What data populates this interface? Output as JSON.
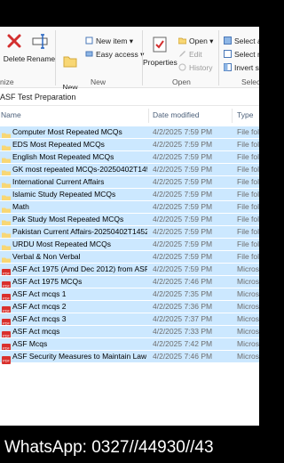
{
  "ribbon": {
    "delete_label": "Delete",
    "rename_label": "Rename",
    "new_folder_label": "New\nfolder",
    "new_item_label": "New item ▾",
    "easy_access_label": "Easy access ▾",
    "properties_label": "Properties",
    "open_label": "Open ▾",
    "edit_label": "Edit",
    "history_label": "History",
    "select_all_label": "Select all",
    "select_none_label": "Select no",
    "invert_selection_label": "Invert se",
    "group_organize": "nize",
    "group_new": "New",
    "group_open": "Open",
    "group_select": "Selec"
  },
  "address": {
    "crumb": "ASF Test Preparation"
  },
  "columns": {
    "name": "Name",
    "date": "Date modified",
    "type": "Type"
  },
  "files": [
    {
      "name": "Computer Most Repeated MCQs",
      "date": "4/2/2025 7:59 PM",
      "type": "File fold",
      "kind": "folder"
    },
    {
      "name": "EDS Most Repeated MCQs",
      "date": "4/2/2025 7:59 PM",
      "type": "File fold",
      "kind": "folder"
    },
    {
      "name": "English Most Repeated MCQs",
      "date": "4/2/2025 7:59 PM",
      "type": "File fold",
      "kind": "folder"
    },
    {
      "name": "GK most repeated MCQs-20250402T1451...",
      "date": "4/2/2025 7:59 PM",
      "type": "File fold",
      "kind": "folder"
    },
    {
      "name": "International Current Affairs",
      "date": "4/2/2025 7:59 PM",
      "type": "File fold",
      "kind": "folder"
    },
    {
      "name": "Islamic Study Repeated MCQs",
      "date": "4/2/2025 7:59 PM",
      "type": "File fold",
      "kind": "folder"
    },
    {
      "name": "Math",
      "date": "4/2/2025 7:59 PM",
      "type": "File fold",
      "kind": "folder"
    },
    {
      "name": "Pak Study Most Repeated MCQs",
      "date": "4/2/2025 7:59 PM",
      "type": "File fold",
      "kind": "folder"
    },
    {
      "name": "Pakistan Current Affairs-20250402T14523...",
      "date": "4/2/2025 7:59 PM",
      "type": "File fold",
      "kind": "folder"
    },
    {
      "name": "URDU Most Repeated MCQs",
      "date": "4/2/2025 7:59 PM",
      "type": "File fold",
      "kind": "folder"
    },
    {
      "name": "Verbal & Non Verbal",
      "date": "4/2/2025 7:59 PM",
      "type": "File fold",
      "kind": "folder"
    },
    {
      "name": "ASF Act 1975 (Amd Dec 2012) from ASF ...",
      "date": "4/2/2025 7:59 PM",
      "type": "Microsc",
      "kind": "pdf"
    },
    {
      "name": "ASF Act 1975 MCQs",
      "date": "4/2/2025 7:46 PM",
      "type": "Microsc",
      "kind": "pdf"
    },
    {
      "name": "ASF Act mcqs 1",
      "date": "4/2/2025 7:35 PM",
      "type": "Microsc",
      "kind": "pdf"
    },
    {
      "name": "ASF Act mcqs 2",
      "date": "4/2/2025 7:36 PM",
      "type": "Microsc",
      "kind": "pdf"
    },
    {
      "name": "ASF Act mcqs 3",
      "date": "4/2/2025 7:37 PM",
      "type": "Microsc",
      "kind": "pdf"
    },
    {
      "name": "ASF Act mcqs",
      "date": "4/2/2025 7:33 PM",
      "type": "Microsc",
      "kind": "pdf"
    },
    {
      "name": "ASF Mcqs",
      "date": "4/2/2025 7:42 PM",
      "type": "Microsc",
      "kind": "pdf"
    },
    {
      "name": "ASF Security Measures to Maintain Law ...",
      "date": "4/2/2025 7:46 PM",
      "type": "Microsc",
      "kind": "pdf"
    }
  ],
  "footer": {
    "text": "WhatsApp: 0327//44930//43"
  },
  "colors": {
    "selection": "#cce8ff",
    "folder": "#f8d775",
    "pdf": "#d9302c",
    "delete": "#d32f2f"
  }
}
